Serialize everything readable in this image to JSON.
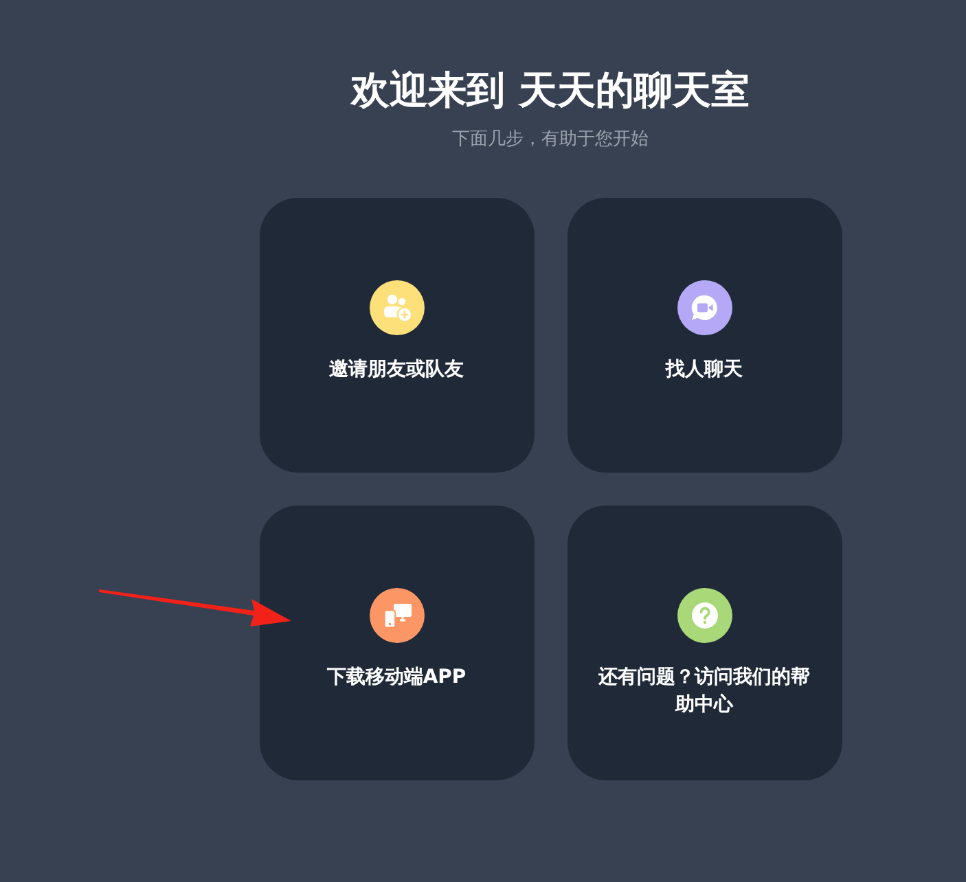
{
  "header": {
    "title": "欢迎来到 天天的聊天室",
    "subtitle": "下面几步，有助于您开始"
  },
  "cards": [
    {
      "label": "邀请朋友或队友",
      "color": "#fde07a"
    },
    {
      "label": "找人聊天",
      "color": "#b5a9f7"
    },
    {
      "label": "下载移动端APP",
      "color": "#fc9765"
    },
    {
      "label": "还有问题？访问我们的帮助中心",
      "color": "#a8d877"
    }
  ]
}
